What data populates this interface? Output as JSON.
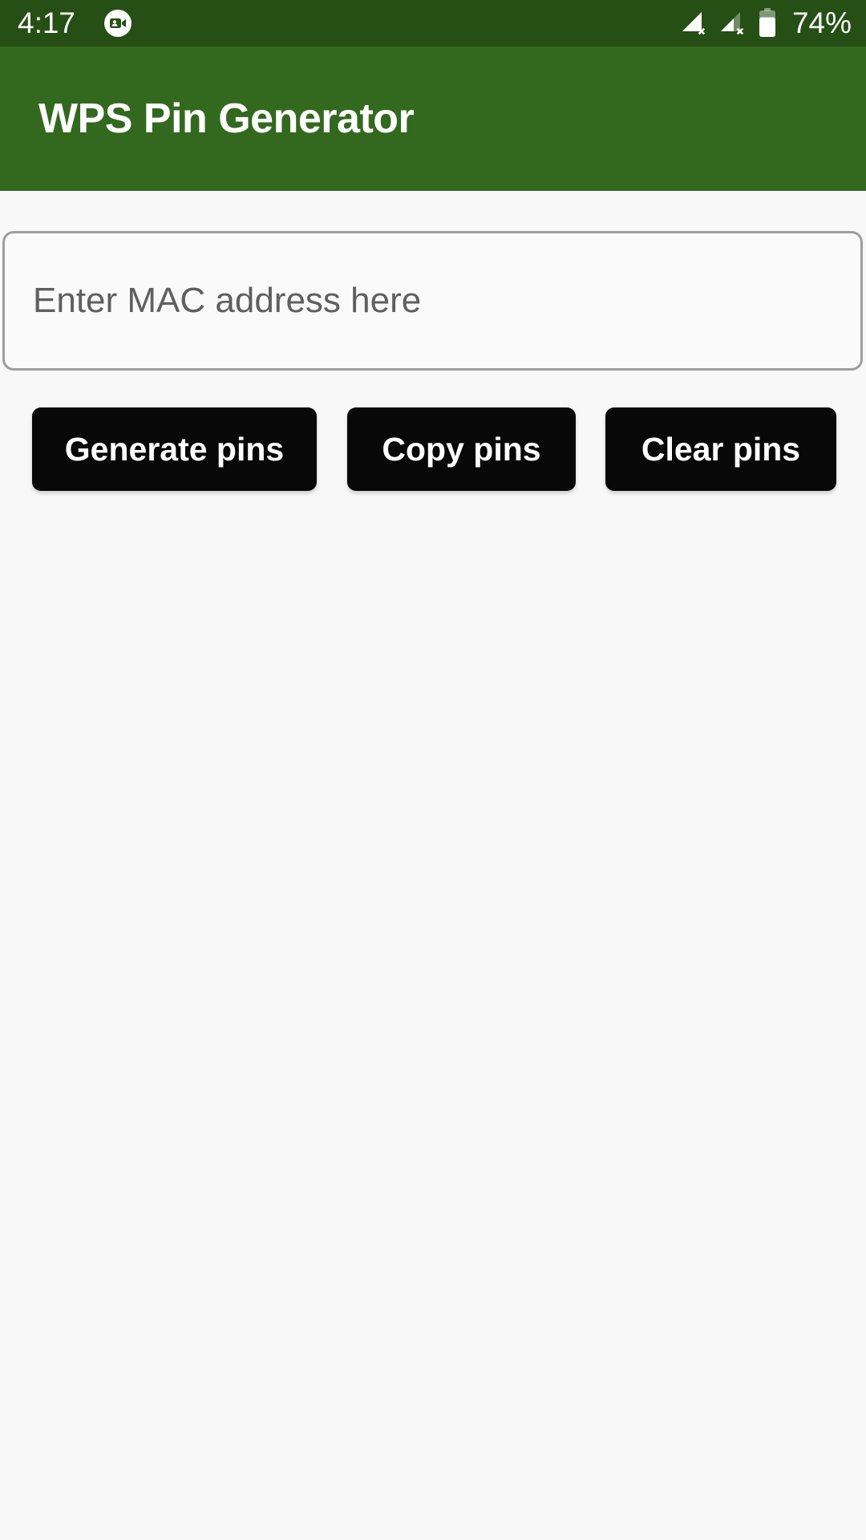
{
  "status_bar": {
    "clock": "4:17",
    "notification_icon": "video-call-icon",
    "signal_icons": [
      "signal-no-sim-icon",
      "signal-no-sim-icon"
    ],
    "battery_icon": "battery-icon",
    "battery_percent": "74%",
    "background_color": "#264f15",
    "foreground_color": "#ffffff"
  },
  "app_bar": {
    "title": "WPS Pin Generator",
    "background_color": "#33691e",
    "title_color": "#ffffff"
  },
  "main": {
    "background_color": "#f8f8f8",
    "mac_input": {
      "name": "mac-address-input",
      "value": "",
      "placeholder": "Enter MAC address here",
      "border_color": "#9e9e9e",
      "placeholder_color": "#5f5f5f"
    },
    "buttons": [
      {
        "name": "generate-pins-button",
        "label": "Generate pins",
        "background_color": "#080808",
        "text_color": "#ffffff"
      },
      {
        "name": "copy-pins-button",
        "label": "Copy pins",
        "background_color": "#080808",
        "text_color": "#ffffff"
      },
      {
        "name": "clear-pins-button",
        "label": "Clear pins",
        "background_color": "#080808",
        "text_color": "#ffffff"
      }
    ],
    "results_area": {
      "name": "pins-results-area",
      "text": ""
    }
  }
}
